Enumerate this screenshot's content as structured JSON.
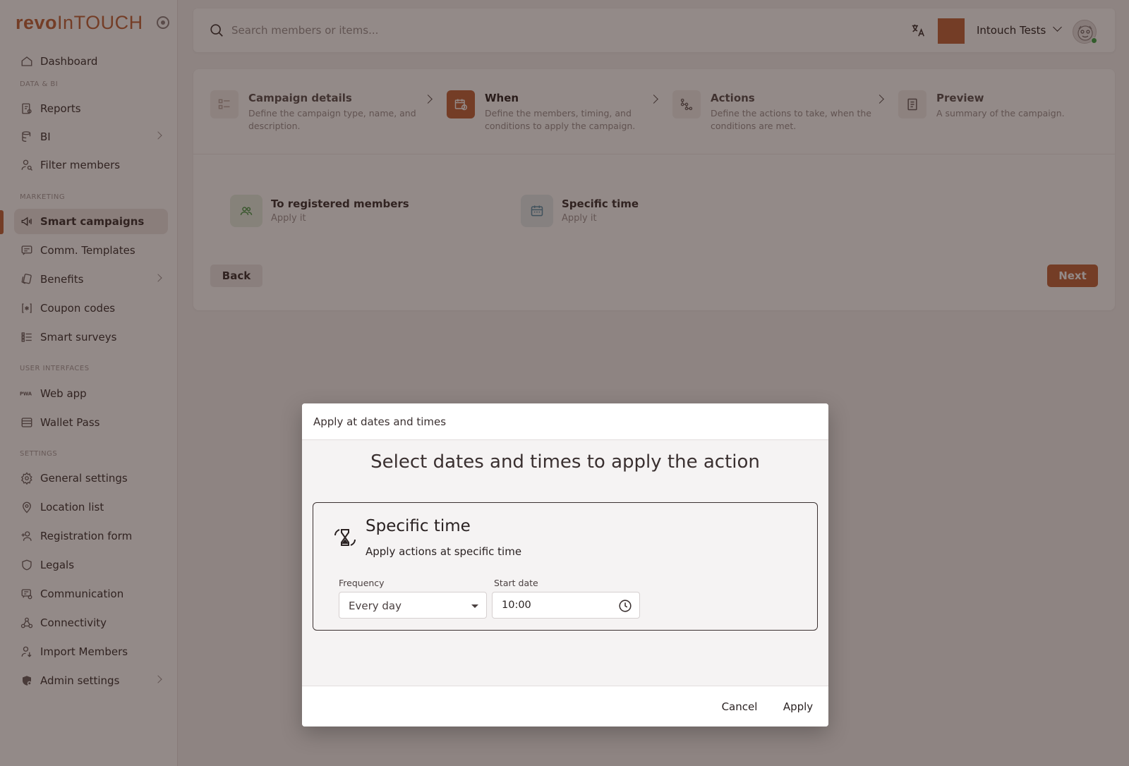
{
  "brand": {
    "logo_bold": "revo",
    "logo_light": "InTOUCH",
    "accent": "#c0643a"
  },
  "sidebar": {
    "sections": [
      {
        "label": "DATA & BI"
      },
      {
        "label": "MARKETING"
      },
      {
        "label": "USER INTERFACES"
      },
      {
        "label": "SETTINGS"
      }
    ],
    "items": [
      {
        "label": "Dashboard",
        "icon": "home-icon"
      },
      {
        "label": "Reports",
        "icon": "report-icon"
      },
      {
        "label": "BI",
        "icon": "database-icon",
        "has_children": true
      },
      {
        "label": "Filter members",
        "icon": "user-search-icon"
      },
      {
        "label": "Smart campaigns",
        "icon": "megaphone-icon",
        "active": true
      },
      {
        "label": "Comm. Templates",
        "icon": "message-icon"
      },
      {
        "label": "Benefits",
        "icon": "cards-icon",
        "has_children": true
      },
      {
        "label": "Coupon codes",
        "icon": "coupon-icon"
      },
      {
        "label": "Smart surveys",
        "icon": "list-icon"
      },
      {
        "label": "Web app",
        "icon": "pwa-icon"
      },
      {
        "label": "Wallet Pass",
        "icon": "wallet-icon"
      },
      {
        "label": "General settings",
        "icon": "gear-icon"
      },
      {
        "label": "Location list",
        "icon": "location-pin-icon"
      },
      {
        "label": "Registration form",
        "icon": "user-plus-icon"
      },
      {
        "label": "Legals",
        "icon": "shield-icon"
      },
      {
        "label": "Communication",
        "icon": "chat-settings-icon"
      },
      {
        "label": "Connectivity",
        "icon": "webhook-icon"
      },
      {
        "label": "Import Members",
        "icon": "user-import-icon"
      },
      {
        "label": "Admin settings",
        "icon": "admin-icon",
        "has_children": true
      }
    ]
  },
  "header": {
    "search_placeholder": "Search members or items...",
    "org_badge_text": "...",
    "org_name": "Intouch Tests"
  },
  "wizard": {
    "steps": [
      {
        "title": "Campaign details",
        "description": "Define the campaign type, name, and description."
      },
      {
        "title": "When",
        "description": "Define the members, timing, and conditions to apply the campaign."
      },
      {
        "title": "Actions",
        "description": "Define the actions to take, when the conditions are met."
      },
      {
        "title": "Preview",
        "description": "A summary of the campaign."
      }
    ],
    "options": [
      {
        "title": "To registered members",
        "subtitle": "Apply it"
      },
      {
        "title": "Specific time",
        "subtitle": "Apply it"
      }
    ],
    "back_label": "Back",
    "next_label": "Next"
  },
  "modal": {
    "title": "Apply at dates and times",
    "heading": "Select dates and times to apply the action",
    "card_title": "Specific time",
    "card_subtitle": "Apply actions at specific time",
    "frequency_label": "Frequency",
    "frequency_value": "Every day",
    "start_label": "Start date",
    "start_value": "10:00",
    "cancel_label": "Cancel",
    "apply_label": "Apply"
  }
}
